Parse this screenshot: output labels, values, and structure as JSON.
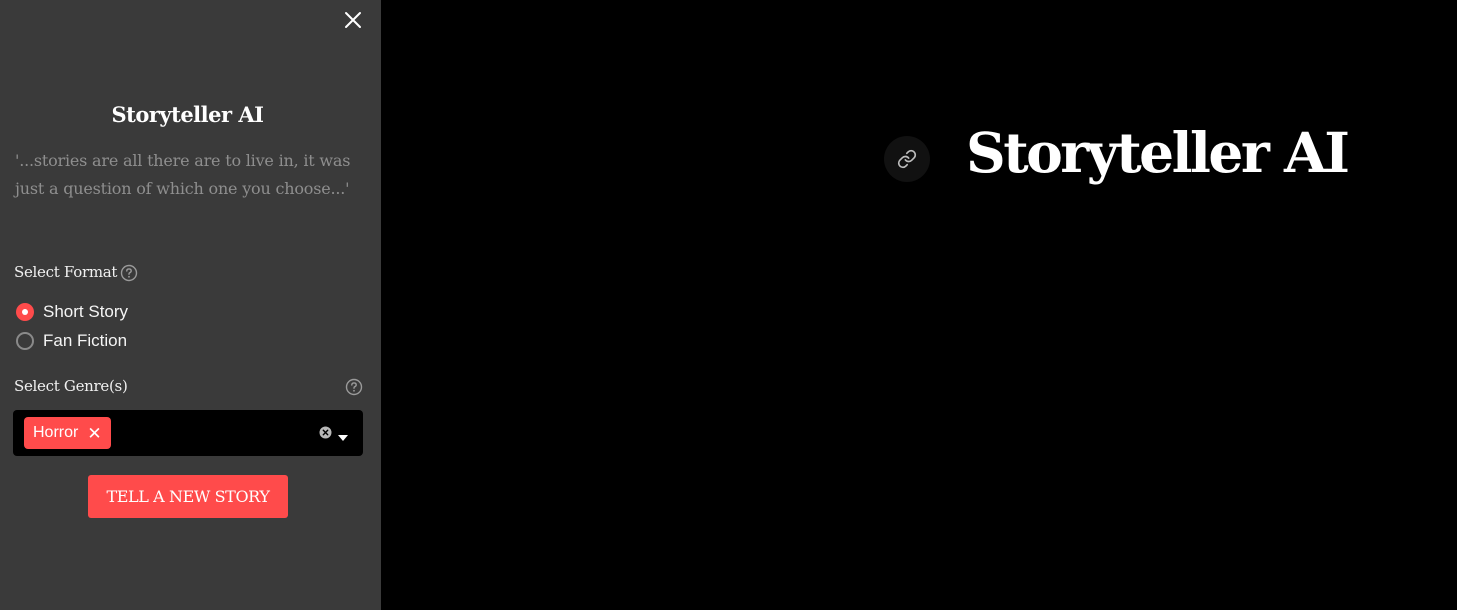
{
  "sidebar": {
    "title": "Storyteller AI",
    "tagline": "'...stories are all there are to live in, it was just a question of which one you choose...'",
    "format": {
      "label": "Select Format",
      "options": [
        {
          "label": "Short Story",
          "selected": true
        },
        {
          "label": "Fan Fiction",
          "selected": false
        }
      ]
    },
    "genres": {
      "label": "Select Genre(s)",
      "selected": [
        "Horror"
      ],
      "tag_remove_glyph": "✕"
    },
    "submit_label": "TELL A NEW STORY"
  },
  "main": {
    "title": "Storyteller AI"
  },
  "icons": {
    "close": "close-icon",
    "help": "help-circle-icon",
    "clear": "clear-circle-icon",
    "dropdown": "caret-down-icon",
    "link": "link-icon"
  },
  "colors": {
    "accent": "#ff4b4b",
    "sidebar_bg": "#3a3a3a",
    "main_bg": "#000000",
    "tagline_text": "#8e8e8e"
  }
}
